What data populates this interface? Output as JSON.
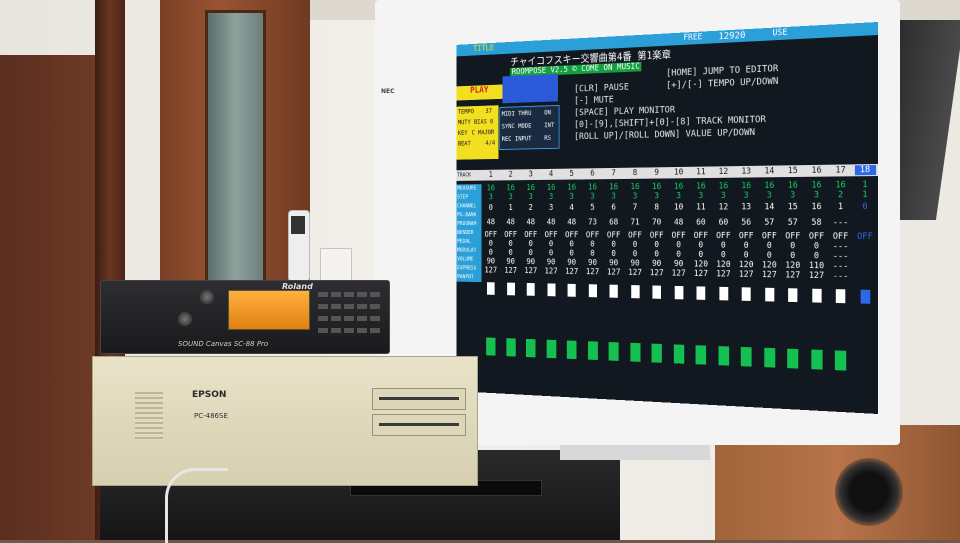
{
  "monitor": {
    "brand": "NEC",
    "title": "チャイコフスキー交響曲第4番 第1楽章",
    "topbar_tags": [
      "TITLE",
      "FREE",
      "12920",
      "USE"
    ],
    "mode": "PLAY",
    "song_tag": "ROOMPOSE V2.5 © COME ON MUSIC",
    "commands": [
      "[CLR]  PAUSE",
      "[-]  MUTE",
      "[SPACE] PLAY MONITOR",
      "[0]-[9],[SHIFT]+[0]-[8] TRACK MONITOR",
      "[ROLL UP]/[ROLL DOWN]  VALUE UP/DOWN",
      "[HOME] JUMP TO EDITOR",
      "[+]/[-] TEMPO UP/DOWN"
    ],
    "params": [
      {
        "label": "TEMPO",
        "value": "37"
      },
      {
        "label": "MUTY BIAS",
        "value": "0"
      },
      {
        "label": "KEY",
        "value": "C MAJOR"
      },
      {
        "label": "BEAT",
        "value": "4/4"
      }
    ],
    "midi": [
      {
        "label": "MIDI THRU",
        "value": "ON"
      },
      {
        "label": "SYNC MODE",
        "value": "INT"
      },
      {
        "label": "REC INPUT",
        "value": "RS"
      }
    ],
    "row_labels": [
      "TRACK",
      "MEASURE",
      "STEP",
      "CHANNEL",
      "PG.BANK",
      "PROGRAM",
      "BENDER",
      "PEDAL",
      "MODULAT",
      "VOLUME",
      "EXPRESS",
      "PANPOT"
    ],
    "tracks": [
      {
        "n": "1",
        "measure": "16",
        "step": "3",
        "ch": "0",
        "prog": "48",
        "bend": "OFF",
        "pedal": "0",
        "mod": "0",
        "vol": "90",
        "expr": "127"
      },
      {
        "n": "2",
        "measure": "16",
        "step": "3",
        "ch": "1",
        "prog": "48",
        "bend": "OFF",
        "pedal": "0",
        "mod": "0",
        "vol": "90",
        "expr": "127"
      },
      {
        "n": "3",
        "measure": "16",
        "step": "3",
        "ch": "2",
        "prog": "48",
        "bend": "OFF",
        "pedal": "0",
        "mod": "0",
        "vol": "90",
        "expr": "127"
      },
      {
        "n": "4",
        "measure": "16",
        "step": "3",
        "ch": "3",
        "prog": "48",
        "bend": "OFF",
        "pedal": "0",
        "mod": "0",
        "vol": "90",
        "expr": "127"
      },
      {
        "n": "5",
        "measure": "16",
        "step": "3",
        "ch": "4",
        "prog": "48",
        "bend": "OFF",
        "pedal": "0",
        "mod": "0",
        "vol": "90",
        "expr": "127"
      },
      {
        "n": "6",
        "measure": "16",
        "step": "3",
        "ch": "5",
        "prog": "73",
        "bend": "OFF",
        "pedal": "0",
        "mod": "0",
        "vol": "90",
        "expr": "127"
      },
      {
        "n": "7",
        "measure": "16",
        "step": "3",
        "ch": "6",
        "prog": "68",
        "bend": "OFF",
        "pedal": "0",
        "mod": "0",
        "vol": "90",
        "expr": "127"
      },
      {
        "n": "8",
        "measure": "16",
        "step": "3",
        "ch": "7",
        "prog": "71",
        "bend": "OFF",
        "pedal": "0",
        "mod": "0",
        "vol": "90",
        "expr": "127"
      },
      {
        "n": "9",
        "measure": "16",
        "step": "3",
        "ch": "8",
        "prog": "70",
        "bend": "OFF",
        "pedal": "0",
        "mod": "0",
        "vol": "90",
        "expr": "127"
      },
      {
        "n": "10",
        "measure": "16",
        "step": "3",
        "ch": "10",
        "prog": "48",
        "bend": "OFF",
        "pedal": "0",
        "mod": "0",
        "vol": "90",
        "expr": "127"
      },
      {
        "n": "11",
        "measure": "16",
        "step": "3",
        "ch": "11",
        "prog": "60",
        "bend": "OFF",
        "pedal": "0",
        "mod": "0",
        "vol": "120",
        "expr": "127"
      },
      {
        "n": "12",
        "measure": "16",
        "step": "3",
        "ch": "12",
        "prog": "60",
        "bend": "OFF",
        "pedal": "0",
        "mod": "0",
        "vol": "120",
        "expr": "127"
      },
      {
        "n": "13",
        "measure": "16",
        "step": "3",
        "ch": "13",
        "prog": "56",
        "bend": "OFF",
        "pedal": "0",
        "mod": "0",
        "vol": "120",
        "expr": "127"
      },
      {
        "n": "14",
        "measure": "16",
        "step": "3",
        "ch": "14",
        "prog": "57",
        "bend": "OFF",
        "pedal": "0",
        "mod": "0",
        "vol": "120",
        "expr": "127"
      },
      {
        "n": "15",
        "measure": "16",
        "step": "3",
        "ch": "15",
        "prog": "57",
        "bend": "OFF",
        "pedal": "0",
        "mod": "0",
        "vol": "120",
        "expr": "127"
      },
      {
        "n": "16",
        "measure": "16",
        "step": "3",
        "ch": "16",
        "prog": "58",
        "bend": "OFF",
        "pedal": "0",
        "mod": "0",
        "vol": "110",
        "expr": "127"
      },
      {
        "n": "17",
        "measure": "16",
        "step": "2",
        "ch": "1",
        "prog": "---",
        "bend": "OFF",
        "pedal": "---",
        "mod": "---",
        "vol": "---",
        "expr": "---"
      },
      {
        "n": "18",
        "measure": "1",
        "step": "1",
        "ch": "0",
        "prog": "",
        "bend": "OFF",
        "pedal": "",
        "mod": "",
        "vol": "",
        "expr": ""
      }
    ]
  },
  "roland": {
    "brand": "Roland",
    "model": "SOUND Canvas SC-88 Pro"
  },
  "epson": {
    "brand": "EPSON",
    "model": "PC-486SE"
  }
}
